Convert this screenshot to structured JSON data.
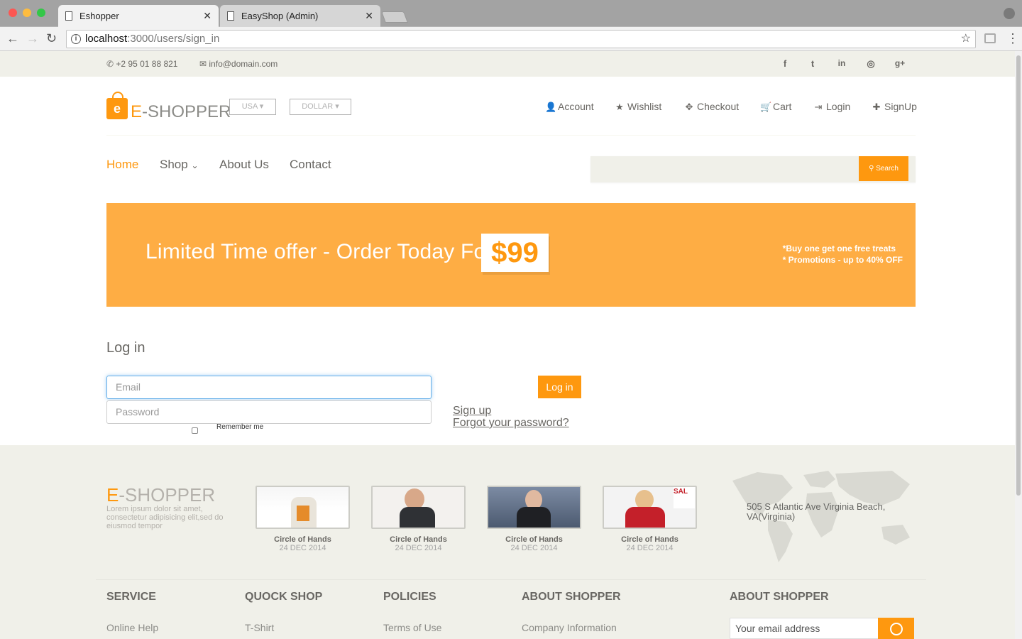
{
  "browser": {
    "tabs": [
      {
        "title": "Eshopper",
        "active": true
      },
      {
        "title": "EasyShop (Admin)",
        "active": false
      }
    ],
    "url_host": "localhost",
    "url_path": ":3000/users/sign_in"
  },
  "topbar": {
    "phone": "+2 95 01 88 821",
    "email": "info@domain.com",
    "social": [
      "f",
      "t",
      "in",
      "dribbble",
      "g+"
    ]
  },
  "header": {
    "logo_letter": "e",
    "logo_text_1": "E",
    "logo_text_2": "-SHOPPER",
    "country": "USA",
    "currency": "DOLLAR",
    "menu": [
      {
        "label": "Account",
        "icon": "user-icon"
      },
      {
        "label": "Wishlist",
        "icon": "star-icon"
      },
      {
        "label": "Checkout",
        "icon": "crosshairs-icon"
      },
      {
        "label": "Cart",
        "icon": "cart-icon"
      },
      {
        "label": "Login",
        "icon": "login-icon"
      },
      {
        "label": "SignUp",
        "icon": "plus-icon"
      }
    ]
  },
  "nav": {
    "items": [
      "Home",
      "Shop",
      "About Us",
      "Contact"
    ],
    "active": "Home",
    "search_button": "Search"
  },
  "banner": {
    "headline": "Limited Time offer - Order Today For",
    "price": "$99",
    "promo_1": "*Buy one get one free treats",
    "promo_2": "* Promotions - up to 40% OFF"
  },
  "login": {
    "title": "Log in",
    "email_placeholder": "Email",
    "password_placeholder": "Password",
    "remember": "Remember me",
    "button": "Log in",
    "signup_link": "Sign up",
    "forgot_link": "Forgot your password?"
  },
  "footer": {
    "logo_1": "E",
    "logo_2": "-SHOPPER",
    "description": "Lorem ipsum dolor sit amet, consectetur adipisicing elit,sed do eiusmod tempor",
    "videos": [
      {
        "title": "Circle of Hands",
        "date": "24 DEC 2014"
      },
      {
        "title": "Circle of Hands",
        "date": "24 DEC 2014"
      },
      {
        "title": "Circle of Hands",
        "date": "24 DEC 2014"
      },
      {
        "title": "Circle of Hands",
        "date": "24 DEC 2014"
      }
    ],
    "address": "505 S Atlantic Ave Virginia Beach, VA(Virginia)",
    "columns": [
      {
        "heading": "SERVICE",
        "first": "Online Help"
      },
      {
        "heading": "QUOCK SHOP",
        "first": "T-Shirt"
      },
      {
        "heading": "POLICIES",
        "first": "Terms of Use"
      },
      {
        "heading": "ABOUT SHOPPER",
        "first": "Company Information"
      },
      {
        "heading": "ABOUT SHOPPER",
        "first": ""
      }
    ],
    "subscribe_placeholder": "Your email address"
  },
  "colors": {
    "brand": "#fe980f",
    "banner": "#fead44",
    "light_bg": "#f0f0e9"
  }
}
